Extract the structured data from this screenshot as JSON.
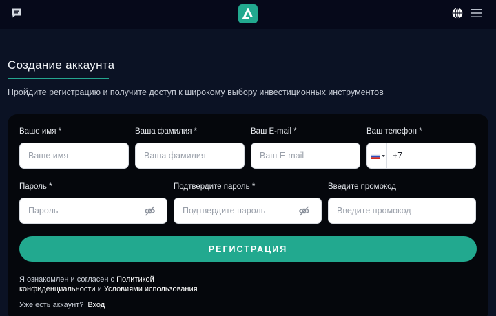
{
  "header": {
    "chat_icon": "chat-icon",
    "logo_icon": "app-logo",
    "language_icon": "globe-icon",
    "menu_icon": "hamburger-menu-icon"
  },
  "page": {
    "title": "Создание аккаунта",
    "subtitle": "Пройдите регистрацию и получите доступ к широкому выбору инвестиционных инструментов"
  },
  "form": {
    "first_name": {
      "label": "Ваше имя *",
      "placeholder": "Ваше имя",
      "value": ""
    },
    "last_name": {
      "label": "Ваша фамилия *",
      "placeholder": "Ваша фамилия",
      "value": ""
    },
    "email": {
      "label": "Ваш E-mail *",
      "placeholder": "Ваш E-mail",
      "value": ""
    },
    "phone": {
      "label": "Ваш телефон *",
      "value": "+7",
      "country": "RU",
      "flag_icon": "russia-flag-icon"
    },
    "password": {
      "label": "Пароль *",
      "placeholder": "Пароль",
      "value": ""
    },
    "confirm_password": {
      "label": "Подтвердите пароль *",
      "placeholder": "Подтвердите пароль",
      "value": ""
    },
    "promo": {
      "label": "Введите промокод",
      "placeholder": "Введите промокод",
      "value": ""
    },
    "submit_label": "РЕГИСТРАЦИЯ"
  },
  "consent": {
    "prefix": "Я ознакомлен и согласен с ",
    "privacy_link": "Политикой конфиденциальности",
    "middle": " и ",
    "terms_link": "Условиями использования"
  },
  "login": {
    "question": "Уже есть аккаунт?",
    "link": "Вход"
  },
  "colors": {
    "background": "#0b1224",
    "header": "#06091a",
    "card": "#05070c",
    "accent": "#22a98f"
  }
}
